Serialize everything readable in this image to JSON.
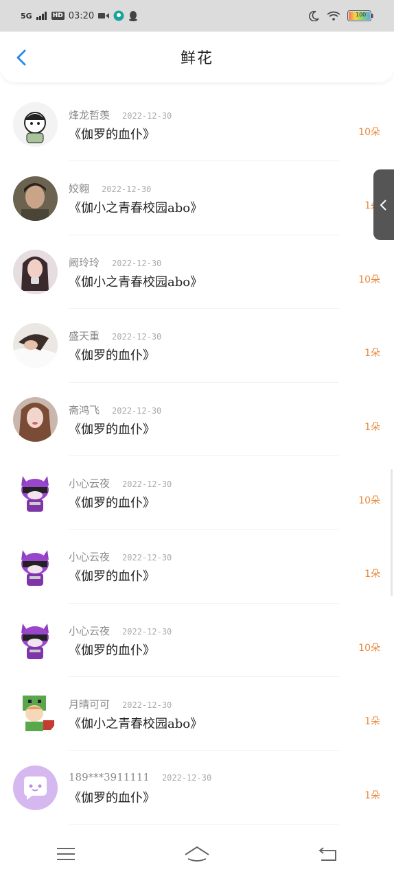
{
  "status_bar": {
    "signal": "5G",
    "hd": "HD",
    "time": "03:20",
    "battery": "100"
  },
  "header": {
    "title": "鲜花"
  },
  "rows": [
    {
      "user": "烽龙哲羡",
      "date": "2022-12-30",
      "book": "《伽罗的血仆》",
      "count": "10朵",
      "avatar": "cartoon-boy"
    },
    {
      "user": "姣翱",
      "date": "2022-12-30",
      "book": "《伽小之青春校园abo》",
      "count": "1朵",
      "avatar": "photo-man"
    },
    {
      "user": "阚玲玲",
      "date": "2022-12-30",
      "book": "《伽小之青春校园abo》",
      "count": "10朵",
      "avatar": "photo-girl"
    },
    {
      "user": "盛天重",
      "date": "2022-12-30",
      "book": "《伽罗的血仆》",
      "count": "1朵",
      "avatar": "photo-cat-girl"
    },
    {
      "user": "斋鸿飞",
      "date": "2022-12-30",
      "book": "《伽罗的血仆》",
      "count": "1朵",
      "avatar": "photo-woman"
    },
    {
      "user": "小心云夜",
      "date": "2022-12-30",
      "book": "《伽罗的血仆》",
      "count": "10朵",
      "avatar": "purple-cat"
    },
    {
      "user": "小心云夜",
      "date": "2022-12-30",
      "book": "《伽罗的血仆》",
      "count": "1朵",
      "avatar": "purple-cat"
    },
    {
      "user": "小心云夜",
      "date": "2022-12-30",
      "book": "《伽罗的血仆》",
      "count": "10朵",
      "avatar": "purple-cat"
    },
    {
      "user": "月晴可可",
      "date": "2022-12-30",
      "book": "《伽小之青春校园abo》",
      "count": "1朵",
      "avatar": "creeper-kid"
    },
    {
      "user": "189***3911111",
      "date": "2022-12-30",
      "book": "《伽罗的血仆》",
      "count": "1朵",
      "avatar": "chat-bubble"
    }
  ],
  "colors": {
    "accent": "#2b8ce8",
    "count": "#e8883a"
  }
}
